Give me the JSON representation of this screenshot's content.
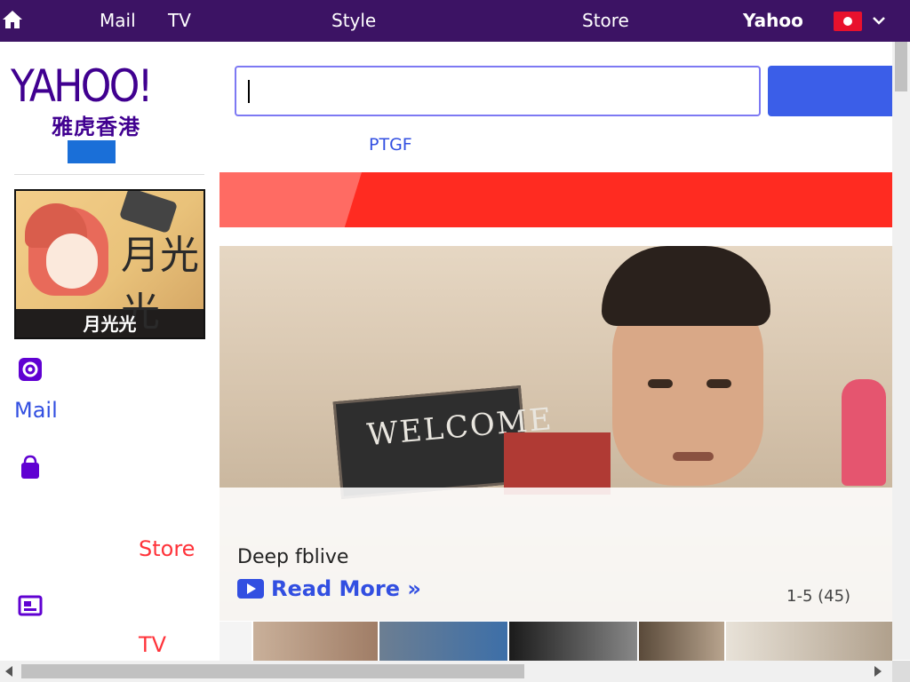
{
  "topbar": {
    "home_label": "",
    "items": [
      "Mail",
      "TV",
      "",
      "",
      "Style",
      "",
      "",
      "",
      "Store",
      ""
    ],
    "yahoo_label": "Yahoo",
    "bg_color": "#3c1364"
  },
  "logo": {
    "wordmark": "YAHOO!",
    "subtitle": "雅虎香港",
    "badge": ""
  },
  "promo": {
    "caption": "月光光",
    "art_glyph": "月光光"
  },
  "sidebar": {
    "section1": {
      "title": "",
      "icon": "gear-icon",
      "links": [
        "Mail",
        ""
      ]
    },
    "section2": {
      "title": "",
      "icon": "shopping-bag-icon",
      "links": [
        "",
        "",
        "",
        "Store"
      ]
    },
    "section3": {
      "title": "",
      "icon": "news-icon",
      "links": [
        "",
        "TV"
      ]
    }
  },
  "search": {
    "placeholder": "",
    "button_label": ""
  },
  "trending": {
    "label": "",
    "items": [
      "PTGF",
      "",
      "",
      "",
      "",
      "",
      ""
    ]
  },
  "breaking": {
    "tag": "",
    "headline": ""
  },
  "hero": {
    "board_text": "WELCOME",
    "title": "",
    "description": "Deep fblive",
    "read_more": "Read More »",
    "pager": "1-5 (45)"
  },
  "colors": {
    "brand_purple": "#400090",
    "link_blue": "#324fe1",
    "breaking_red": "#ff2b21"
  }
}
